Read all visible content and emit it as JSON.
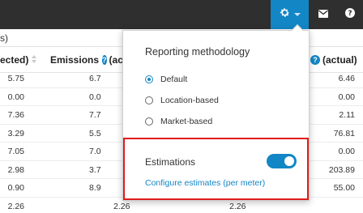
{
  "topbar": {
    "gear_icon": "gear-icon",
    "mail_icon": "mail-icon",
    "help_icon": "help-icon"
  },
  "sub_row": {
    "fragment": "s)"
  },
  "table": {
    "headers": [
      "ected)",
      "Emissions",
      "(actua",
      "(actual)"
    ],
    "rows": [
      [
        "5.75",
        "6.7",
        "6.46"
      ],
      [
        "0.00",
        "0.0",
        "0.00"
      ],
      [
        "7.36",
        "7.7",
        "2.11"
      ],
      [
        "3.29",
        "5.5",
        "76.81"
      ],
      [
        "7.05",
        "7.0",
        "0.00"
      ],
      [
        "2.98",
        "3.7",
        "203.89"
      ],
      [
        "0.90",
        "8.9",
        "55.00"
      ],
      [
        "2.26",
        "2.26",
        "2.26"
      ]
    ]
  },
  "popover": {
    "title": "Reporting methodology",
    "options": [
      {
        "label": "Default",
        "selected": true
      },
      {
        "label": "Location-based",
        "selected": false
      },
      {
        "label": "Market-based",
        "selected": false
      }
    ],
    "estimations_label": "Estimations",
    "estimations_enabled": true,
    "configure_link": "Configure estimates (per meter)"
  },
  "colors": {
    "accent": "#1386c6",
    "topbar": "#2f2f2f",
    "highlight_border": "#e01b1b"
  }
}
